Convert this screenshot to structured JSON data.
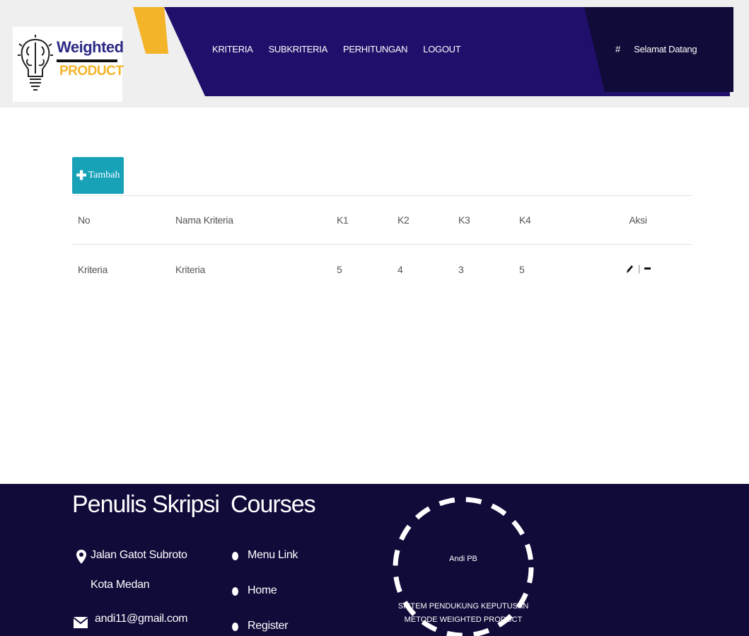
{
  "header": {
    "logo": {
      "title": "Weighted",
      "subtitle": "PRODUCT"
    },
    "menu": [
      {
        "label": "KRITERIA"
      },
      {
        "label": "SUBKRITERIA"
      },
      {
        "label": "PERHITUNGAN"
      },
      {
        "label": "LOGOUT"
      }
    ],
    "greeting": {
      "hash": "#",
      "text": "Selamat Datang"
    },
    "colors": {
      "nav": "#200f6b",
      "nav_dark": "#110b3a",
      "accent": "#f3b429",
      "band": "#efefef"
    }
  },
  "main": {
    "add_button": {
      "icon": "plus-icon",
      "label": "Tambah",
      "color": "#17a2b8"
    },
    "table": {
      "columns": [
        "No",
        "Nama Kriteria",
        "K1",
        "K2",
        "K3",
        "K4",
        "Aksi"
      ],
      "rows": [
        {
          "no": "Kriteria",
          "nama": "Kriteria",
          "k1": "5",
          "k2": "4",
          "k3": "3",
          "k4": "5",
          "sep": "|"
        }
      ]
    }
  },
  "footer": {
    "col1": {
      "title": "Penulis Skripsi",
      "address1": "Jalan Gatot Subroto",
      "address2": "Kota Medan",
      "email": "andi11@gmail.com"
    },
    "col2": {
      "title": "Courses",
      "links": [
        "Menu Link",
        "Home",
        "Register"
      ]
    },
    "badge": {
      "name": "Andi PB",
      "line1": "SISTEM PENDUKUNG KEPUTUSAN",
      "line2": "METODE WEIGHTED PRODUCT"
    },
    "color": "#110b3a"
  }
}
